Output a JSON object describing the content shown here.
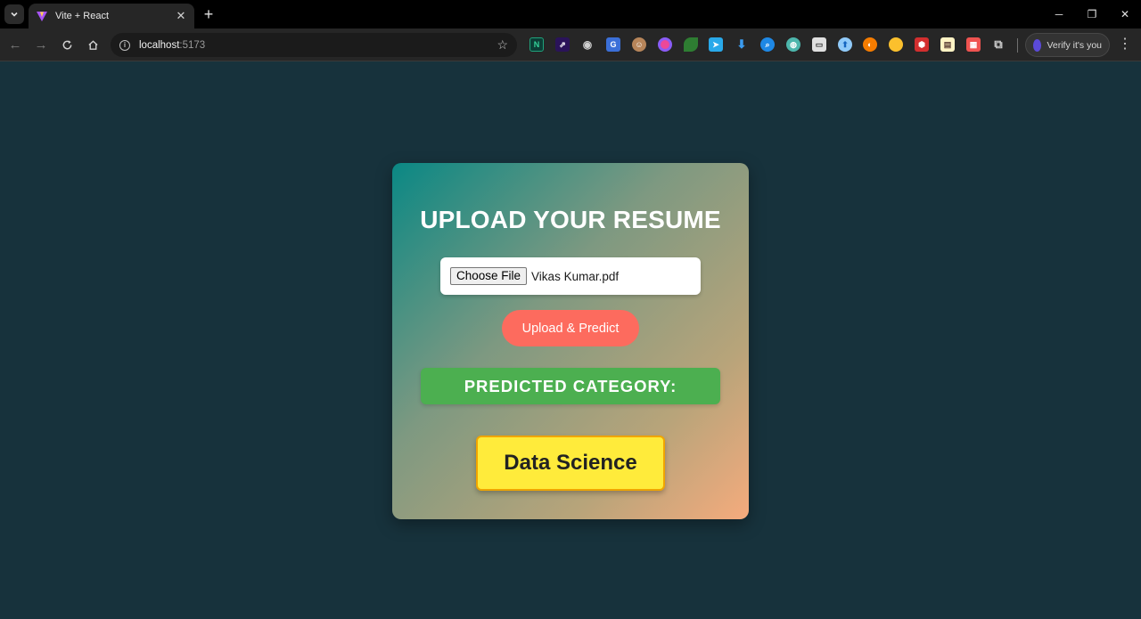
{
  "browser": {
    "tab_title": "Vite + React",
    "url_host": "localhost",
    "url_port": ":5173",
    "profile_label": "Verify it's you",
    "extension_icons": [
      "notion-icon",
      "shortcut-icon",
      "camera-icon",
      "translate-icon",
      "avatar-ext-icon",
      "color-ring-icon",
      "leaf-icon",
      "telegram-icon",
      "download-icon",
      "search-ext-icon",
      "globe-icon",
      "wallet-icon",
      "upload-ext-icon",
      "orange-ext-icon",
      "badge-ext-icon",
      "red-puzzle-icon",
      "note-ext-icon",
      "pdf-ext-icon",
      "extensions-puzzle-icon"
    ]
  },
  "card": {
    "title": "UPLOAD YOUR RESUME",
    "choose_file_label": "Choose File",
    "file_name": "Vikas Kumar.pdf",
    "upload_label": "Upload & Predict",
    "predicted_label": "PREDICTED CATEGORY:",
    "prediction": "Data Science"
  },
  "colors": {
    "page_bg": "#17323c",
    "button": "#fd6b5e",
    "predicted_bar": "#4caf50",
    "result_box": "#ffeb3b",
    "gradient_start": "#0a8884",
    "gradient_end": "#f5ab7d"
  }
}
